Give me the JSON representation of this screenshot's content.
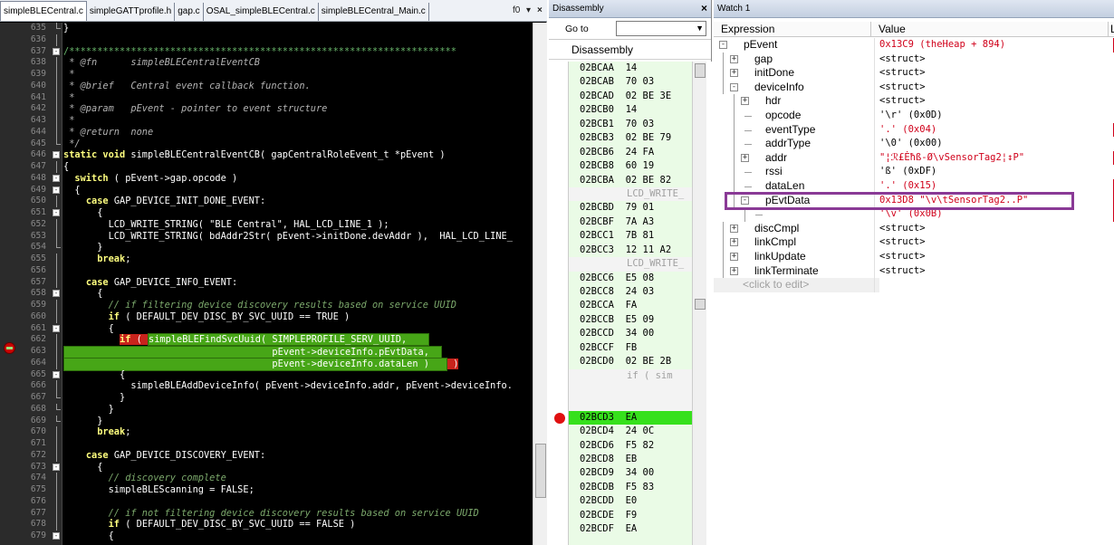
{
  "editor": {
    "tabs": [
      "simpleBLECentral.c",
      "simpleGATTprofile.h",
      "gap.c",
      "OSAL_simpleBLECentral.c",
      "simpleBLECentral_Main.c"
    ],
    "tab_func_label": "f0",
    "lines": [
      {
        "n": "635",
        "t": "}",
        "c": "n"
      },
      {
        "n": "636",
        "t": "",
        "c": "n"
      },
      {
        "n": "637",
        "t": "/*********************************************************************",
        "c": "bar"
      },
      {
        "n": "638",
        "t": " * @fn      simpleBLECentralEventCB",
        "c": "cm"
      },
      {
        "n": "639",
        "t": " *",
        "c": "cm"
      },
      {
        "n": "640",
        "t": " * @brief   Central event callback function.",
        "c": "cm"
      },
      {
        "n": "641",
        "t": " *",
        "c": "cm"
      },
      {
        "n": "642",
        "t": " * @param   pEvent - pointer to event structure",
        "c": "cm"
      },
      {
        "n": "643",
        "t": " *",
        "c": "cm"
      },
      {
        "n": "644",
        "t": " * @return  none",
        "c": "cm"
      },
      {
        "n": "645",
        "t": " */",
        "c": "cm"
      },
      {
        "n": "646",
        "t": "static void simpleBLECentralEventCB( gapCentralRoleEvent_t *pEvent )",
        "c": "sig"
      },
      {
        "n": "647",
        "t": "{",
        "c": "n"
      },
      {
        "n": "648",
        "t": "  switch ( pEvent->gap.opcode )",
        "c": "sw"
      },
      {
        "n": "649",
        "t": "  {",
        "c": "n"
      },
      {
        "n": "650",
        "t": "    case GAP_DEVICE_INIT_DONE_EVENT:",
        "c": "case"
      },
      {
        "n": "651",
        "t": "      {",
        "c": "n"
      },
      {
        "n": "652",
        "t": "        LCD_WRITE_STRING( \"BLE Central\", HAL_LCD_LINE_1 );",
        "c": "n"
      },
      {
        "n": "653",
        "t": "        LCD_WRITE_STRING( bdAddr2Str( pEvent->initDone.devAddr ),  HAL_LCD_LINE_",
        "c": "n"
      },
      {
        "n": "654",
        "t": "      }",
        "c": "n"
      },
      {
        "n": "655",
        "t": "      break;",
        "c": "brk"
      },
      {
        "n": "656",
        "t": "",
        "c": "n"
      },
      {
        "n": "657",
        "t": "    case GAP_DEVICE_INFO_EVENT:",
        "c": "case"
      },
      {
        "n": "658",
        "t": "      {",
        "c": "n"
      },
      {
        "n": "659",
        "t": "        // if filtering device discovery results based on service UUID",
        "c": "cmg"
      },
      {
        "n": "660",
        "t": "        if ( DEFAULT_DEV_DISC_BY_SVC_UUID == TRUE )",
        "c": "if"
      },
      {
        "n": "661",
        "t": "        {",
        "c": "n"
      },
      {
        "n": "662",
        "t": "          if ( simpleBLEFindSvcUuid( SIMPLEPROFILE_SERV_UUID,",
        "c": "cur1"
      },
      {
        "n": "663",
        "t": "                                     pEvent->deviceInfo.pEvtData,",
        "c": "cur2"
      },
      {
        "n": "664",
        "t": "                                     pEvent->deviceInfo.dataLen ) )",
        "c": "cur3"
      },
      {
        "n": "665",
        "t": "          {",
        "c": "n"
      },
      {
        "n": "666",
        "t": "            simpleBLEAddDeviceInfo( pEvent->deviceInfo.addr, pEvent->deviceInfo.",
        "c": "n"
      },
      {
        "n": "667",
        "t": "          }",
        "c": "n"
      },
      {
        "n": "668",
        "t": "        }",
        "c": "n"
      },
      {
        "n": "669",
        "t": "      }",
        "c": "n"
      },
      {
        "n": "670",
        "t": "      break;",
        "c": "brk"
      },
      {
        "n": "671",
        "t": "",
        "c": "n"
      },
      {
        "n": "672",
        "t": "    case GAP_DEVICE_DISCOVERY_EVENT:",
        "c": "case"
      },
      {
        "n": "673",
        "t": "      {",
        "c": "n"
      },
      {
        "n": "674",
        "t": "        // discovery complete",
        "c": "cmg"
      },
      {
        "n": "675",
        "t": "        simpleBLEScanning = FALSE;",
        "c": "n"
      },
      {
        "n": "676",
        "t": "",
        "c": "n"
      },
      {
        "n": "677",
        "t": "        // if not filtering device discovery results based on service UUID",
        "c": "cmg"
      },
      {
        "n": "678",
        "t": "        if ( DEFAULT_DEV_DISC_BY_SVC_UUID == FALSE )",
        "c": "if"
      },
      {
        "n": "679",
        "t": "        {",
        "c": "n"
      }
    ]
  },
  "disassembly": {
    "title": "Disassembly",
    "goto_label": "Go to",
    "header": "Disassembly",
    "rows": [
      {
        "t": "02BCAA  14",
        "k": "a"
      },
      {
        "t": "02BCAB  70 03",
        "k": "a"
      },
      {
        "t": "02BCAD  02 BE 3E",
        "k": "a"
      },
      {
        "t": "02BCB0  14",
        "k": "a"
      },
      {
        "t": "02BCB1  70 03",
        "k": "a"
      },
      {
        "t": "02BCB3  02 BE 79",
        "k": "a"
      },
      {
        "t": "02BCB6  24 FA",
        "k": "a"
      },
      {
        "t": "02BCB8  60 19",
        "k": "a"
      },
      {
        "t": "02BCBA  02 BE 82",
        "k": "a"
      },
      {
        "t": "LCD_WRITE_",
        "k": "src"
      },
      {
        "t": "02BCBD  79 01",
        "k": "a"
      },
      {
        "t": "02BCBF  7A A3",
        "k": "a"
      },
      {
        "t": "02BCC1  7B 81",
        "k": "a"
      },
      {
        "t": "02BCC3  12 11 A2",
        "k": "a"
      },
      {
        "t": "LCD_WRITE_",
        "k": "src"
      },
      {
        "t": "02BCC6  E5 08",
        "k": "a"
      },
      {
        "t": "02BCC8  24 03",
        "k": "a"
      },
      {
        "t": "02BCCA  FA",
        "k": "a"
      },
      {
        "t": "02BCCB  E5 09",
        "k": "a"
      },
      {
        "t": "02BCCD  34 00",
        "k": "a"
      },
      {
        "t": "02BCCF  FB",
        "k": "a"
      },
      {
        "t": "02BCD0  02 BE 2B",
        "k": "a"
      },
      {
        "t": "if ( sim",
        "k": "srctall"
      },
      {
        "t": "02BCD3  EA",
        "k": "cur"
      },
      {
        "t": "02BCD4  24 0C",
        "k": "a"
      },
      {
        "t": "02BCD6  F5 82",
        "k": "a"
      },
      {
        "t": "02BCD8  EB",
        "k": "a"
      },
      {
        "t": "02BCD9  34 00",
        "k": "a"
      },
      {
        "t": "02BCDB  F5 83",
        "k": "a"
      },
      {
        "t": "02BCDD  E0",
        "k": "a"
      },
      {
        "t": "02BCDE  F9",
        "k": "a"
      },
      {
        "t": "02BCDF  EA",
        "k": "a"
      }
    ]
  },
  "watch": {
    "title": "Watch 1",
    "col_expression": "Expression",
    "col_value": "Value",
    "col_type": "L",
    "rows": [
      {
        "name": "pEvent",
        "value": "0x13C9 (theHeap + 894)",
        "red": true,
        "depth": 0,
        "box": "-"
      },
      {
        "name": "gap",
        "value": "<struct>",
        "red": false,
        "depth": 1,
        "box": "+"
      },
      {
        "name": "initDone",
        "value": "<struct>",
        "red": false,
        "depth": 1,
        "box": "+"
      },
      {
        "name": "deviceInfo",
        "value": "<struct>",
        "red": false,
        "depth": 1,
        "box": "-"
      },
      {
        "name": "hdr",
        "value": "<struct>",
        "red": false,
        "depth": 2,
        "box": "+"
      },
      {
        "name": "opcode",
        "value": "'\\r' (0x0D)",
        "red": false,
        "depth": 2,
        "box": ""
      },
      {
        "name": "eventType",
        "value": "'.' (0x04)",
        "red": true,
        "depth": 2,
        "box": ""
      },
      {
        "name": "addrType",
        "value": "'\\0' (0x00)",
        "red": false,
        "depth": 2,
        "box": ""
      },
      {
        "name": "addr",
        "value": "\"¦ℛ£Ėħß-Ø\\vSensorTag2¦↕P\"",
        "red": true,
        "depth": 2,
        "box": "+"
      },
      {
        "name": "rssi",
        "value": "'ß' (0xDF)",
        "red": false,
        "depth": 2,
        "box": ""
      },
      {
        "name": "dataLen",
        "value": "'.' (0x15)",
        "red": true,
        "depth": 2,
        "box": ""
      },
      {
        "name": "pEvtData",
        "value": "0x13D8 \"\\v\\tSensorTag2..P\"",
        "red": true,
        "depth": 2,
        "box": "-"
      },
      {
        "name": "",
        "value": "'\\v' (0x0B)",
        "red": true,
        "depth": 3,
        "box": ""
      },
      {
        "name": "discCmpl",
        "value": "<struct>",
        "red": false,
        "depth": 1,
        "box": "+"
      },
      {
        "name": "linkCmpl",
        "value": "<struct>",
        "red": false,
        "depth": 1,
        "box": "+"
      },
      {
        "name": "linkUpdate",
        "value": "<struct>",
        "red": false,
        "depth": 1,
        "box": "+"
      },
      {
        "name": "linkTerminate",
        "value": "<struct>",
        "red": false,
        "depth": 1,
        "box": "+"
      }
    ],
    "click_to_edit": "<click to edit>"
  },
  "colors": {
    "highlight_box": "#8a3a96",
    "current_statement": "#47a617",
    "breakpoint": "#c8231c"
  }
}
